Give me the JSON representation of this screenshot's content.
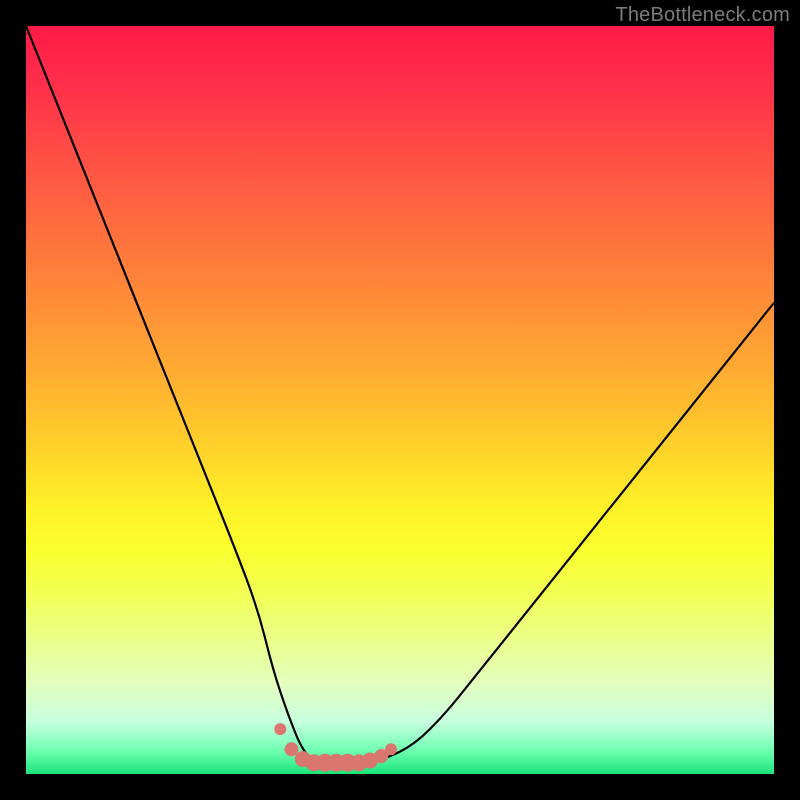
{
  "watermark": "TheBottleneck.com",
  "colors": {
    "frame_bg": "#000000",
    "curve_stroke": "#000000",
    "accent_dots": "#d8766f",
    "accent_dot_fill": "#d8766f",
    "green": "#19e37a",
    "red": "#ff1a47"
  },
  "chart_data": {
    "type": "line",
    "title": "",
    "xlabel": "",
    "ylabel": "",
    "xlim": [
      0,
      100
    ],
    "ylim": [
      0,
      100
    ],
    "grid": false,
    "legend": false,
    "description": "Bottleneck-style curve: steep left descent into a flat valley, rising more gently on the right. Background is a vertical temperature gradient (red top → green bottom).",
    "series": [
      {
        "name": "bottleneck-curve",
        "x": [
          0,
          4,
          8,
          12,
          16,
          20,
          24,
          28,
          31,
          33,
          35,
          37,
          39,
          41,
          43,
          45,
          48,
          52,
          56,
          60,
          64,
          68,
          72,
          76,
          80,
          84,
          88,
          92,
          96,
          100
        ],
        "y": [
          100,
          90,
          80,
          70,
          60,
          50,
          40,
          30,
          22,
          14,
          8,
          3,
          1.5,
          1.5,
          1.5,
          1.5,
          2,
          4,
          8,
          13,
          18,
          23,
          28,
          33,
          38,
          43,
          48,
          53,
          58,
          63
        ]
      }
    ],
    "valley_markers": {
      "name": "valley-dots",
      "x": [
        34.0,
        35.5,
        37.0,
        38.5,
        40.0,
        41.5,
        43.0,
        44.5,
        46.0,
        47.5,
        48.8
      ],
      "y": [
        6.0,
        3.3,
        2.0,
        1.5,
        1.5,
        1.5,
        1.5,
        1.5,
        1.8,
        2.4,
        3.3
      ],
      "r": [
        6,
        7,
        8,
        8.5,
        9,
        9,
        9,
        8.5,
        8,
        7,
        6
      ]
    }
  }
}
